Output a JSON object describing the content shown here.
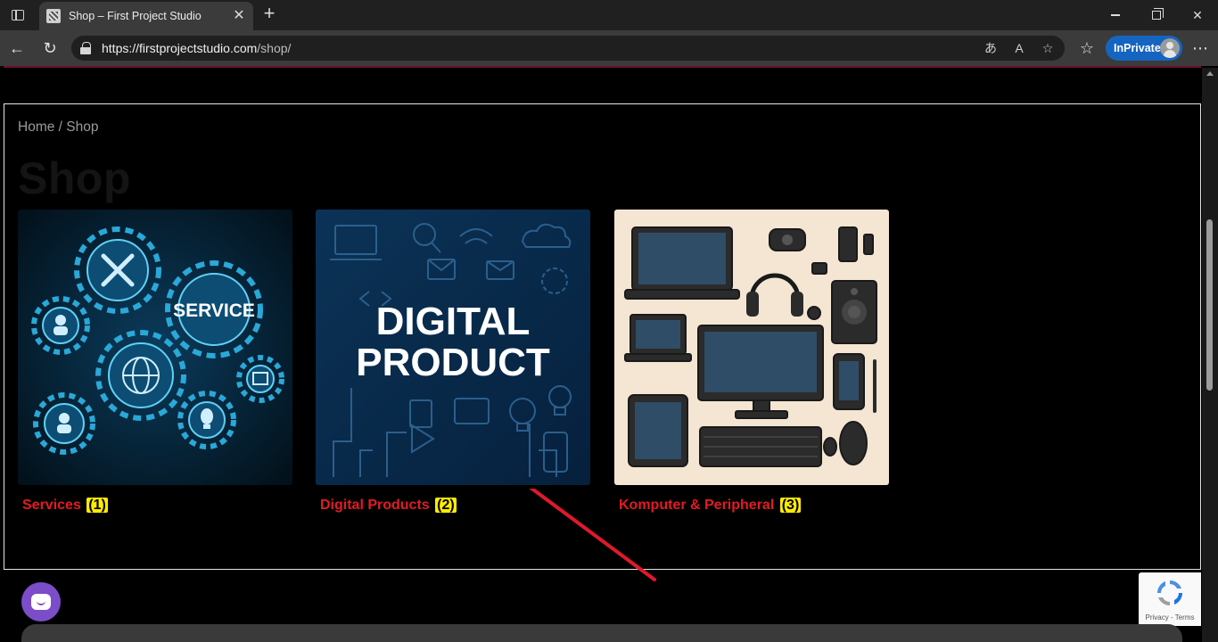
{
  "browser": {
    "tab_title": "Shop – First Project Studio",
    "url_host": "https://firstprojectstudio.com",
    "url_path": "/shop/",
    "inprivate_label": "InPrivate",
    "icons": {
      "tab_actions": "tab-actions-icon",
      "close_tab": "close-icon",
      "new_tab": "plus-icon",
      "back": "back-arrow-icon",
      "reload": "reload-icon",
      "site_info": "lock-icon",
      "translate": "translate-icon",
      "read_aloud": "read-aloud-icon",
      "favorite": "star-icon",
      "collections": "favorites-list-icon",
      "more": "more-dots-icon"
    }
  },
  "page": {
    "breadcrumb_home": "Home",
    "breadcrumb_sep": " / ",
    "breadcrumb_current": "Shop",
    "title": "Shop",
    "categories": [
      {
        "name": "Services",
        "count": "(1)"
      },
      {
        "name": "Digital Products",
        "count": "(2)"
      },
      {
        "name": "Komputer & Peripheral",
        "count": "(3)"
      }
    ],
    "digital_image_line1": "DIGITAL",
    "digital_image_line2": "PRODUCT",
    "services_image_text": "SERVICE"
  },
  "recaptcha": {
    "links": "Privacy - Terms"
  },
  "colors": {
    "accent_label": "#e31b23",
    "count_badge": "#ffeb00",
    "arrow": "#e0192a",
    "inprivate": "#1565c0",
    "chat": "#7b4dc8"
  }
}
